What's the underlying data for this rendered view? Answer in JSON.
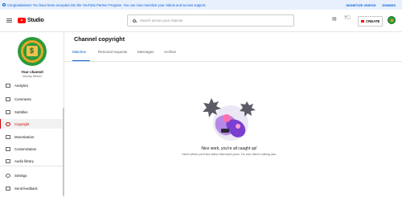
{
  "banner": {
    "message": "Congratulations! You have been accepted into the YouTube Partner Program. You can now monetize your videos and access support.",
    "monetize": "MONETIZE VIDEOS",
    "dismiss": "DISMISS"
  },
  "header": {
    "app_name": "Studio",
    "search_placeholder": "Search across your channel",
    "create_label": "CREATE"
  },
  "channel": {
    "label": "Your channel",
    "name": "Money Wheel"
  },
  "sidebar": {
    "items": [
      {
        "label": "Analytics",
        "icon": "analytics-icon"
      },
      {
        "label": "Comments",
        "icon": "comments-icon"
      },
      {
        "label": "Subtitles",
        "icon": "subtitles-icon"
      },
      {
        "label": "Copyright",
        "icon": "copyright-icon",
        "active": true
      },
      {
        "label": "Monetization",
        "icon": "monetization-icon"
      },
      {
        "label": "Customization",
        "icon": "customization-icon"
      },
      {
        "label": "Audio library",
        "icon": "audio-library-icon"
      },
      {
        "label": "Settings",
        "icon": "settings-icon"
      },
      {
        "label": "Send feedback",
        "icon": "feedback-icon"
      }
    ]
  },
  "main": {
    "title": "Channel copyright",
    "tabs": [
      {
        "label": "Matches",
        "active": true
      },
      {
        "label": "Removal requests"
      },
      {
        "label": "Messages"
      },
      {
        "label": "Archive"
      }
    ],
    "empty_title": "Nice work, you're all caught up!",
    "empty_subtitle": "Here's where you'll find videos that match yours. For now, there's nothing new."
  },
  "colors": {
    "accent": "#065fd4",
    "brand": "#ff0000",
    "active_nav": "#cc0000"
  }
}
